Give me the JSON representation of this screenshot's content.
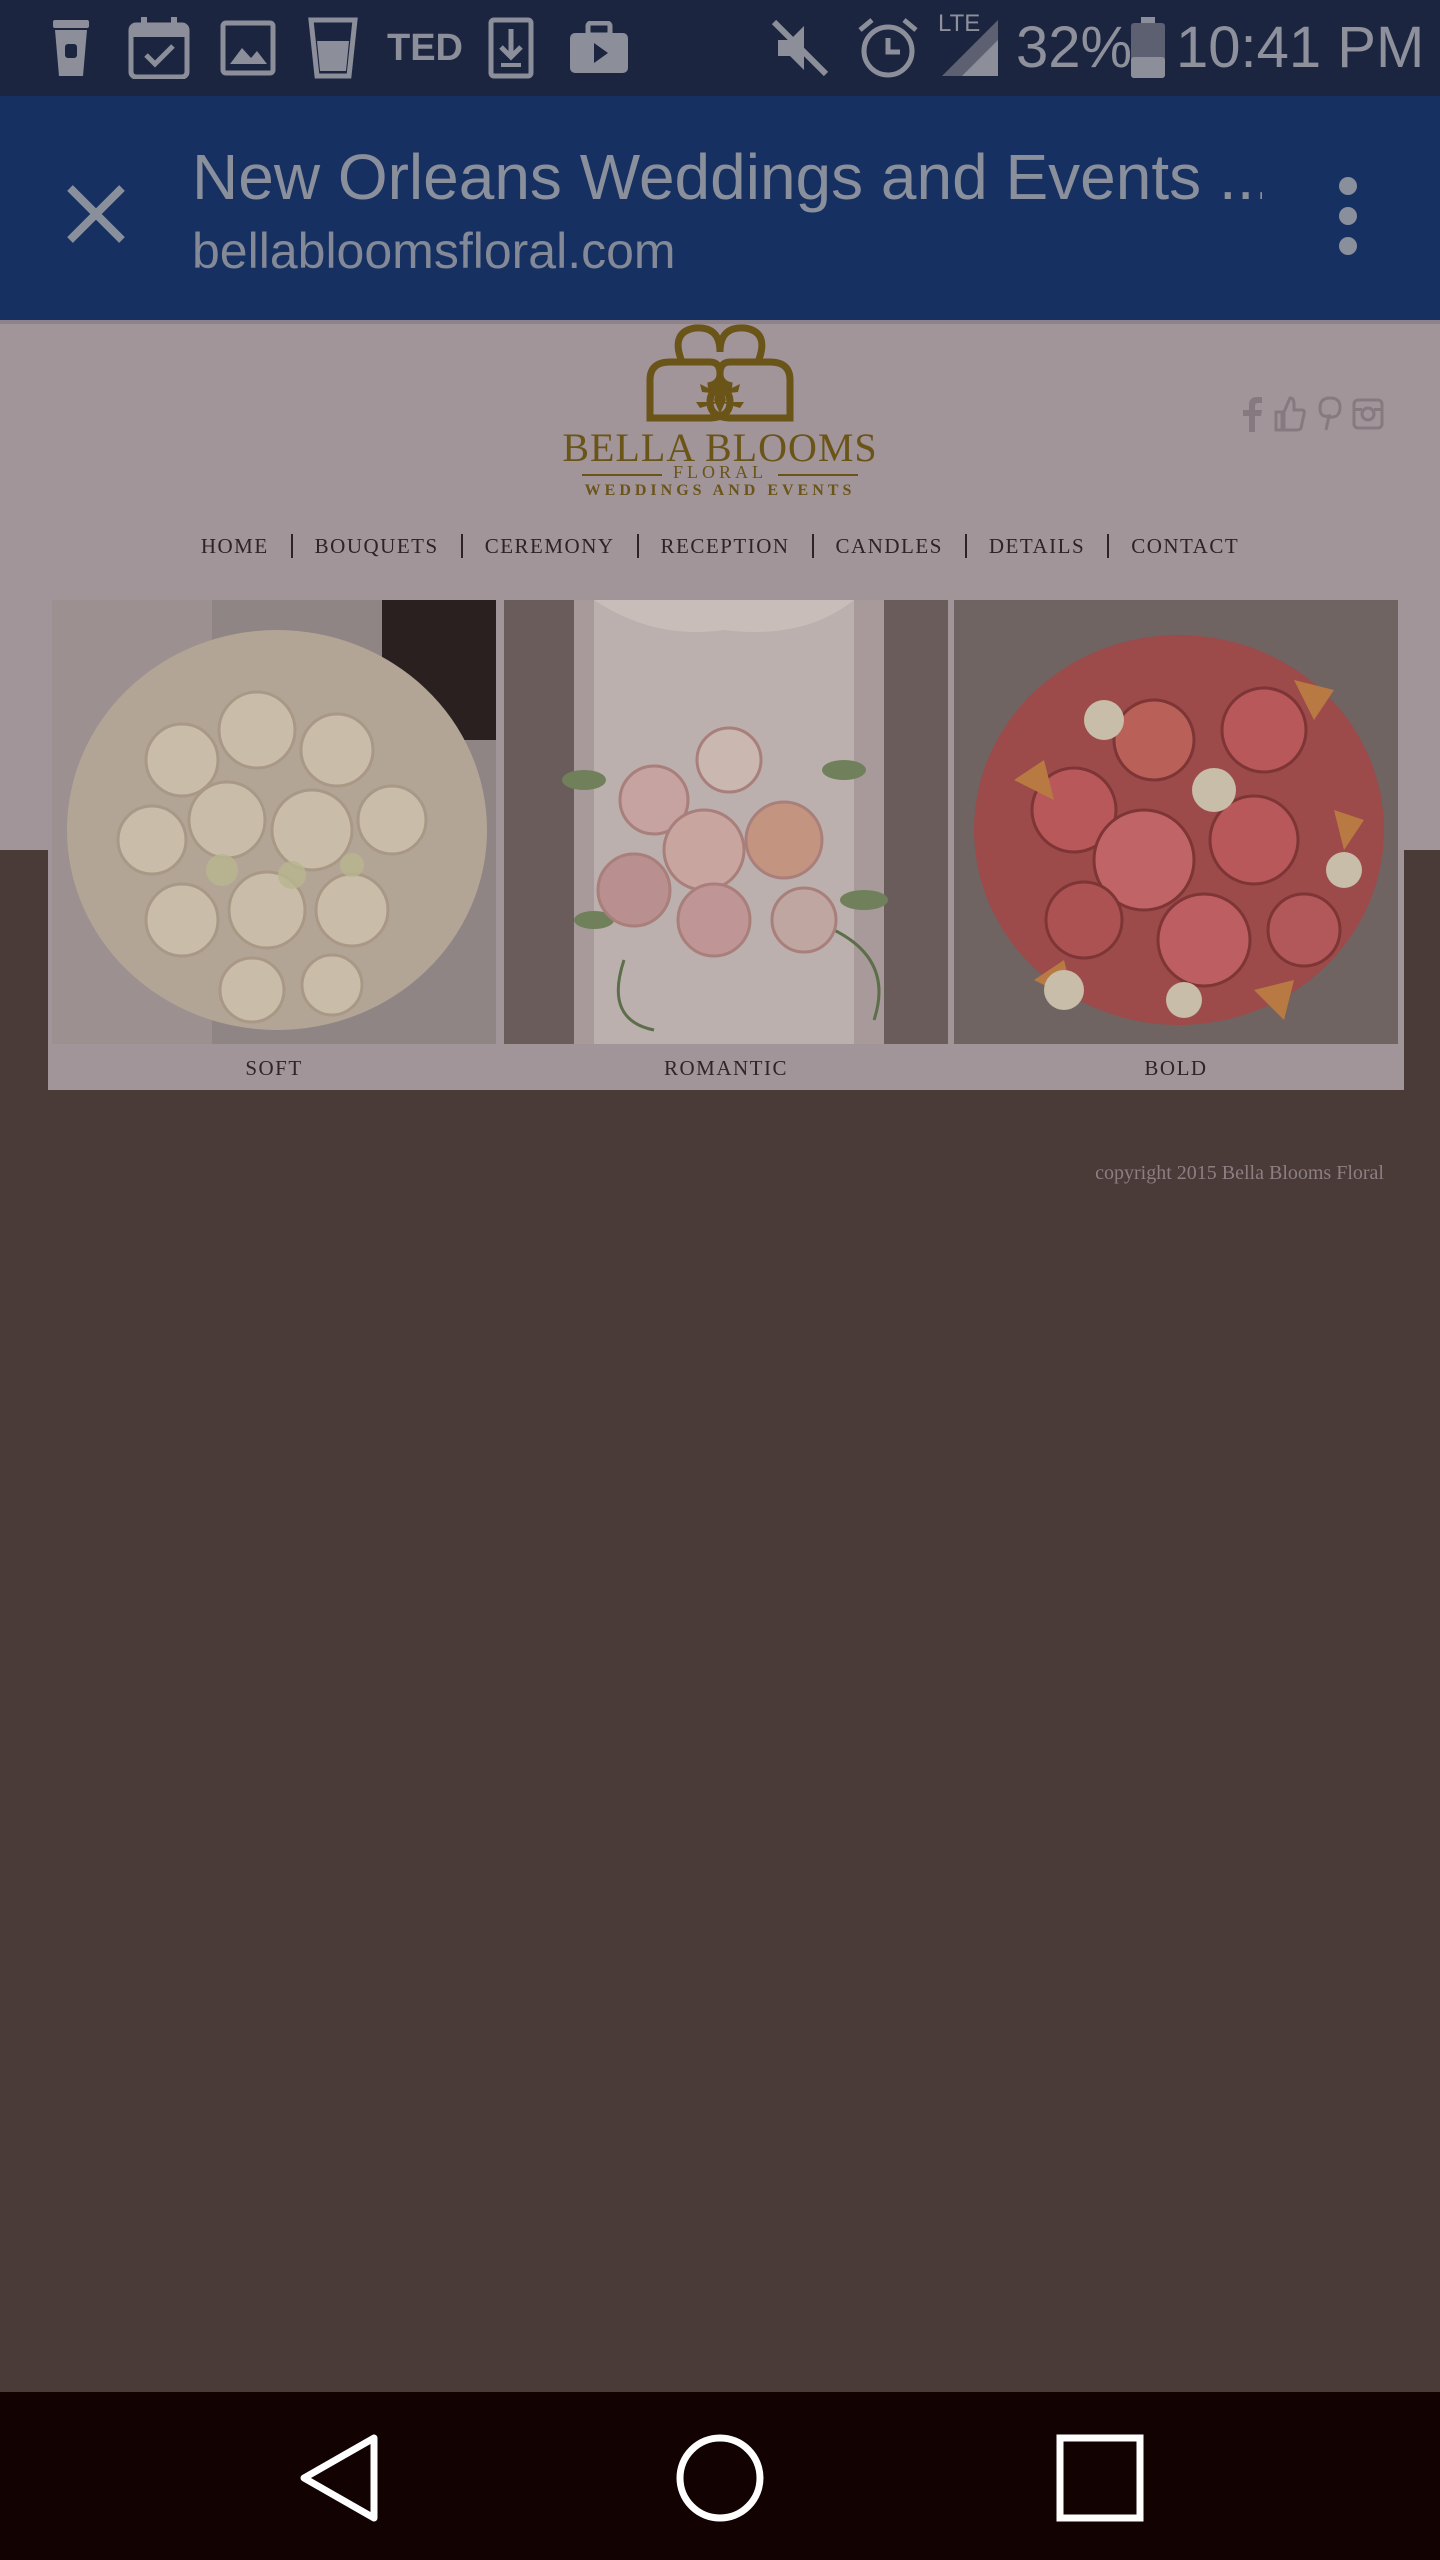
{
  "status_bar": {
    "time": "10:41 PM",
    "battery": "32%",
    "network": "LTE",
    "notification_icons": [
      "coffee-cup-icon",
      "calendar-check-icon",
      "gallery-icon",
      "glass-icon",
      "ted-icon",
      "download-icon",
      "briefcase-icon"
    ],
    "ted_label": "TED"
  },
  "app_bar": {
    "title": "New Orleans Weddings and Events ...",
    "url": "bellabloomsfloral.com"
  },
  "site": {
    "logo": {
      "name": "BELLA BLOOMS",
      "sub1": "FLORAL",
      "sub2": "WEDDINGS AND EVENTS"
    },
    "social": [
      "facebook-icon",
      "thumbs-up-icon",
      "pinterest-icon",
      "instagram-icon"
    ],
    "nav": [
      "HOME",
      "BOUQUETS",
      "CEREMONY",
      "RECEPTION",
      "CANDLES",
      "DETAILS",
      "CONTACT"
    ],
    "gallery": [
      {
        "label": "SOFT"
      },
      {
        "label": "ROMANTIC"
      },
      {
        "label": "BOLD"
      }
    ],
    "copyright": "copyright 2015 Bella Blooms Floral"
  },
  "colors": {
    "status_bar": "#1b2540",
    "app_bar": "#173062",
    "page_dimmed": "#a1959a",
    "background_dimmed": "#4a3b39",
    "brand_gold": "#6a5418",
    "nav_bar": "#120302"
  }
}
